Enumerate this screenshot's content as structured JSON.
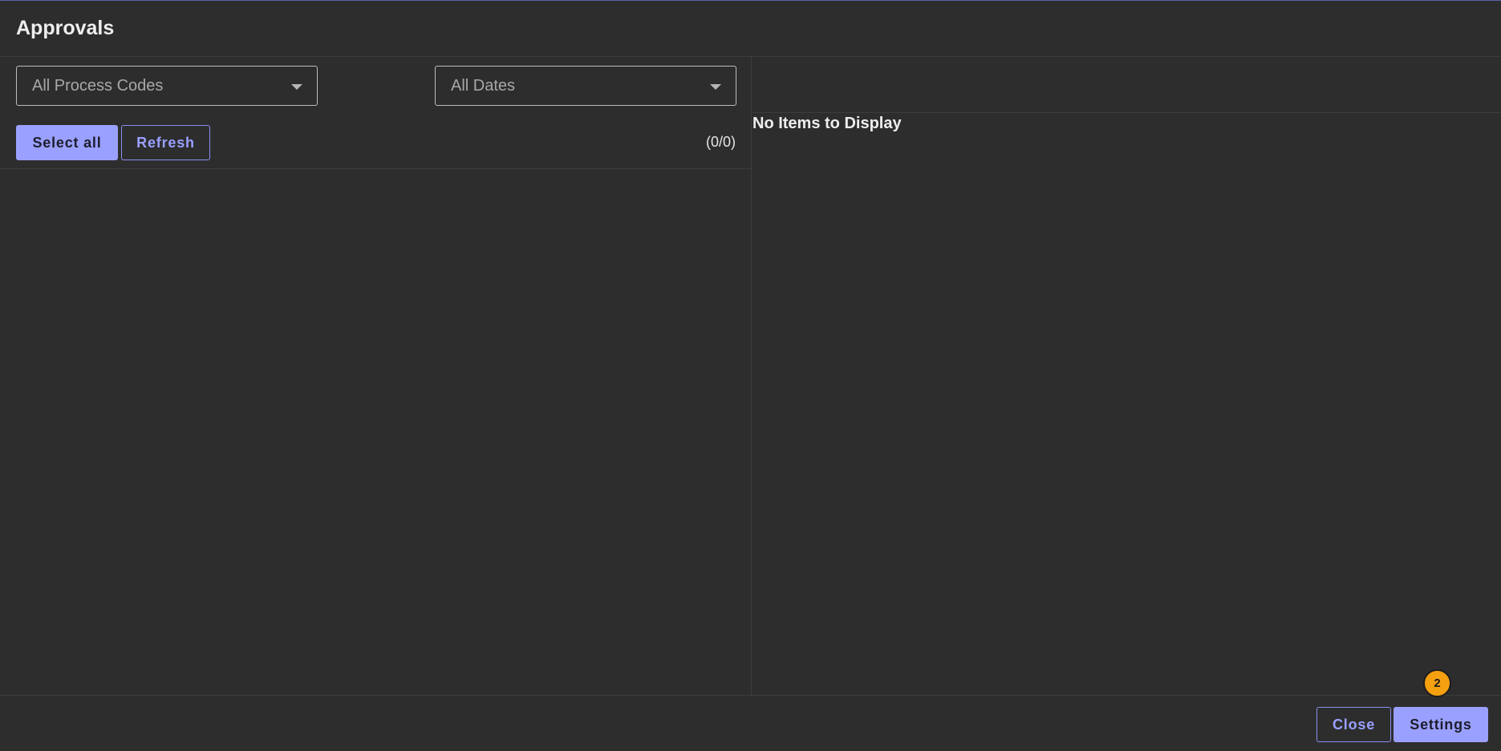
{
  "dialog": {
    "title": "Approvals"
  },
  "filters": {
    "process_codes": {
      "selected": "All Process Codes"
    },
    "dates": {
      "selected": "All Dates"
    }
  },
  "toolbar": {
    "select_all_label": "Select all",
    "refresh_label": "Refresh",
    "count": "(0/0)"
  },
  "detail": {
    "empty_message": "No Items to Display"
  },
  "footer": {
    "close_label": "Close",
    "settings_label": "Settings",
    "badge_count": "2"
  },
  "colors": {
    "background": "#2d2d2d",
    "accent": "#9aa0ff",
    "badge": "#f5a00f"
  }
}
